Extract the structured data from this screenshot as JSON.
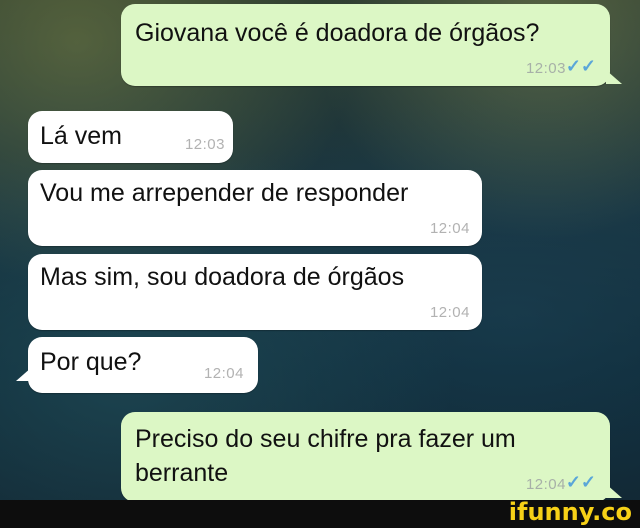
{
  "messages": [
    {
      "text": "Giovana você é doadora de órgãos?",
      "time": "12:03",
      "ticks": "✓✓"
    },
    {
      "text": "Lá vem",
      "time": "12:03"
    },
    {
      "text": "Vou me arrepender de responder",
      "time": "12:04"
    },
    {
      "text": "Mas sim, sou doadora de órgãos",
      "time": "12:04"
    },
    {
      "text": "Por que?",
      "time": "12:04"
    },
    {
      "text": "Preciso do seu chifre pra fazer um\nberrante",
      "time": "12:04",
      "ticks": "✓✓"
    }
  ],
  "watermark": "ifunny.co",
  "colors": {
    "outgoing_bubble": "#dcf7c5",
    "incoming_bubble": "#ffffff",
    "read_ticks": "#5aa6d8",
    "watermark": "#f7d117"
  }
}
